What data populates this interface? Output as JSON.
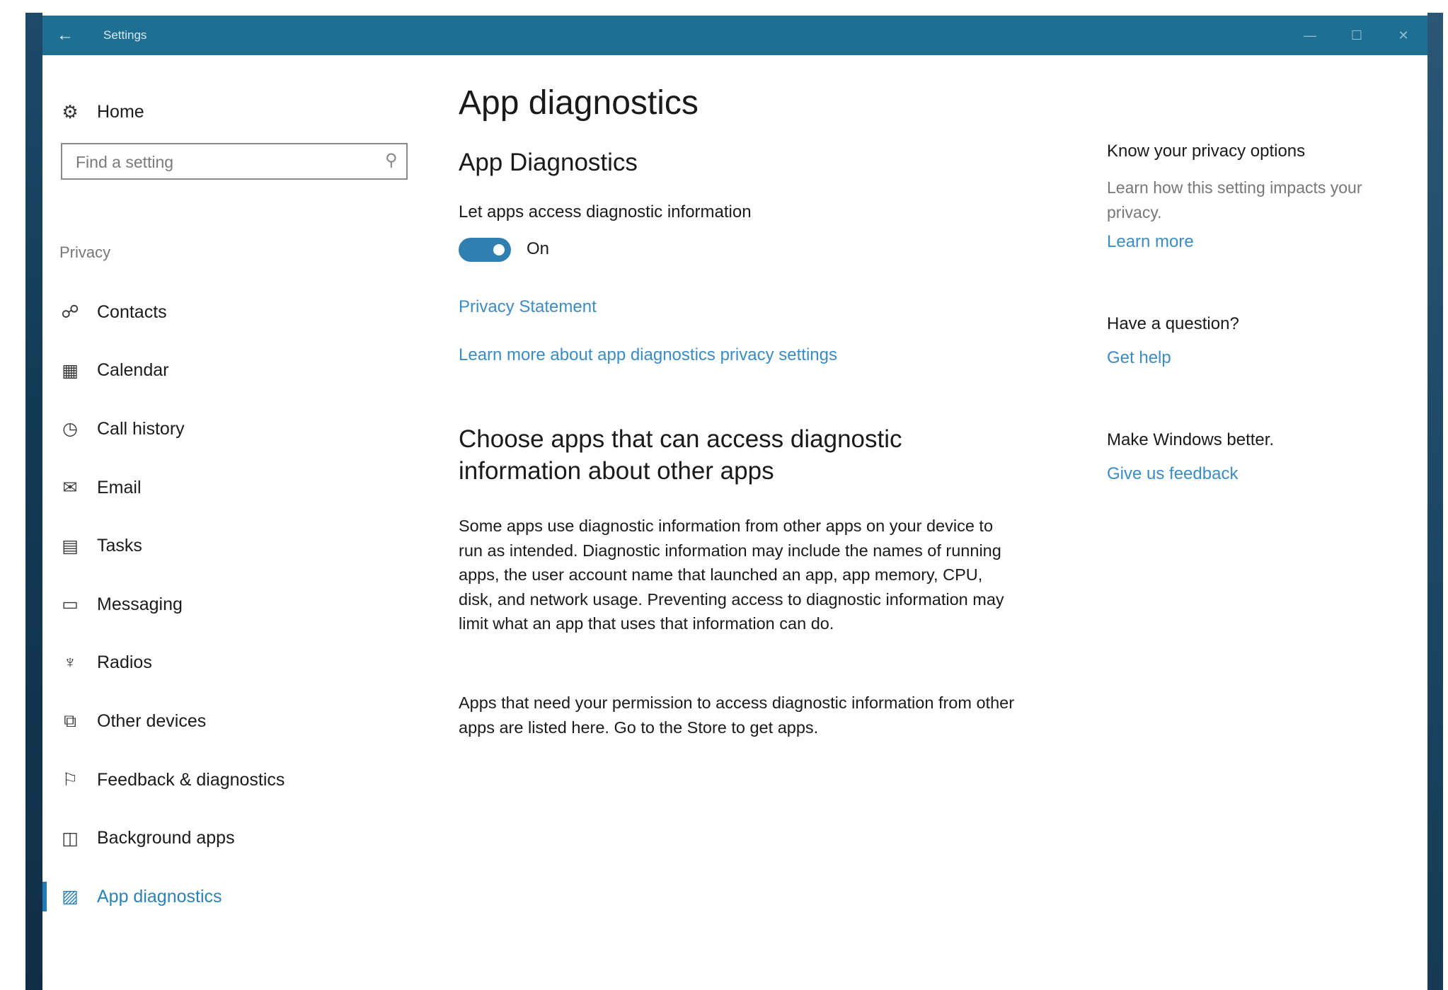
{
  "window": {
    "title": "Settings",
    "back_label": "←",
    "minimize_label": "—",
    "maximize_label": "☐",
    "close_label": "✕"
  },
  "sidebar": {
    "home_label": "Home",
    "search_placeholder": "Find a setting",
    "section_label": "Privacy",
    "items": [
      {
        "label": "Contacts",
        "icon": "contacts-icon"
      },
      {
        "label": "Calendar",
        "icon": "calendar-icon"
      },
      {
        "label": "Call history",
        "icon": "call-history-icon"
      },
      {
        "label": "Email",
        "icon": "email-icon"
      },
      {
        "label": "Tasks",
        "icon": "tasks-icon"
      },
      {
        "label": "Messaging",
        "icon": "messaging-icon"
      },
      {
        "label": "Radios",
        "icon": "radios-icon"
      },
      {
        "label": "Other devices",
        "icon": "other-devices-icon"
      },
      {
        "label": "Feedback & diagnostics",
        "icon": "feedback-icon"
      },
      {
        "label": "Background apps",
        "icon": "background-apps-icon"
      },
      {
        "label": "App diagnostics",
        "icon": "app-diagnostics-icon",
        "active": true
      }
    ]
  },
  "main": {
    "page_title": "App diagnostics",
    "sub_title": "App Diagnostics",
    "setting_label": "Let apps access diagnostic information",
    "toggle_state": "On",
    "toggle_on": true,
    "privacy_link": "Privacy Statement",
    "learn_link": "Learn more about app diagnostics privacy settings",
    "section_title": "Choose apps that can access diagnostic information about other apps",
    "description_1": "Some apps use diagnostic information from other apps on your device to run as intended. Diagnostic information may include the names of running apps, the user account name that launched an app, app memory, CPU, disk, and network usage. Preventing access to diagnostic information may limit what an app that uses that information can do.",
    "description_2": "Apps that need your permission to access diagnostic information from other apps are listed here. Go to the Store to get apps."
  },
  "side": {
    "privacy_heading": "Know your privacy options",
    "privacy_text": "Learn how this setting impacts your privacy.",
    "privacy_link": "Learn more",
    "question_heading": "Have a question?",
    "help_link": "Get help",
    "better_heading": "Make Windows better.",
    "feedback_link": "Give us feedback"
  },
  "colors": {
    "titlebar": "#1f6f93",
    "accent": "#2f7fb0",
    "link": "#3c8cc4"
  }
}
